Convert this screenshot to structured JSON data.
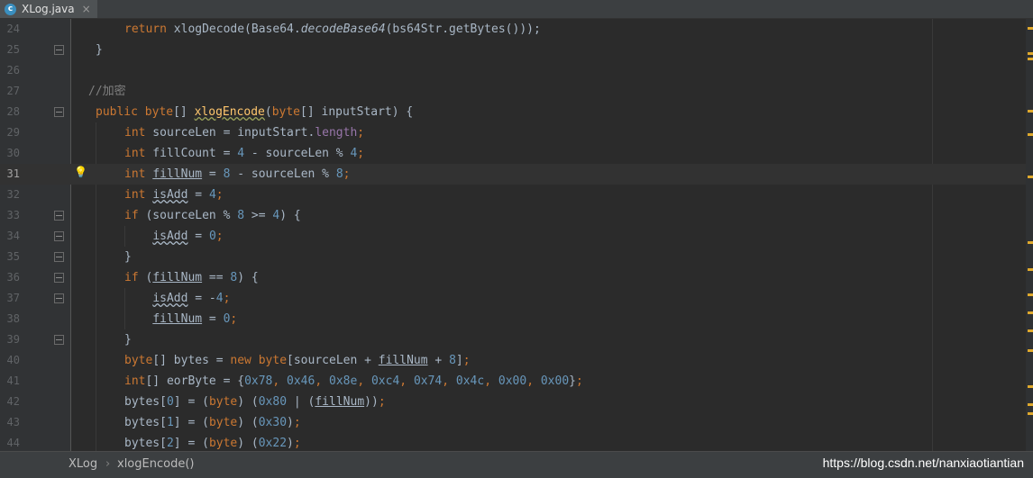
{
  "tab": {
    "icon": "java-class-icon",
    "title": "XLog.java",
    "close": "×"
  },
  "editor": {
    "current_line": 31,
    "lines": [
      {
        "n": "24",
        "code": "<span class=\"kw\">return</span> xlogDecode(Base64.<span class=\"ital\">decodeBase64</span>(bs64Str.getBytes())<span>);</span>"
      },
      {
        "n": "25",
        "code": "}"
      },
      {
        "n": "26",
        "code": ""
      },
      {
        "n": "27",
        "code": "<span class=\"cmt\">//加密</span>"
      },
      {
        "n": "28",
        "code": "<span class=\"kw\">public</span> <span class=\"kw\">byte</span>[] <span class=\"mth wavyok\">xlogEncode</span>(<span class=\"kw\">byte</span>[] inputStart) {"
      },
      {
        "n": "29",
        "code": "<span class=\"kw\">int</span> sourceLen = inputStart.<span class=\"fld\">length</span><span class=\"kw\">;</span>"
      },
      {
        "n": "30",
        "code": "<span class=\"kw\">int</span> fillCount = <span class=\"num\">4</span> - sourceLen % <span class=\"num\">4</span><span class=\"kw\">;</span>"
      },
      {
        "n": "31",
        "code": "<span class=\"kw\">int</span> <span class=\"und\">fillNum</span> = <span class=\"num\">8</span> - sourceLen % <span class=\"num\">8</span><span class=\"kw\">;</span>"
      },
      {
        "n": "32",
        "code": "<span class=\"kw\">int</span> <span class=\"wavy\">isAdd</span> = <span class=\"num\">4</span><span class=\"kw\">;</span>"
      },
      {
        "n": "33",
        "code": "<span class=\"kw\">if</span> (sourceLen % <span class=\"num\">8</span> &gt;= <span class=\"num\">4</span>) {"
      },
      {
        "n": "34",
        "code": "    <span class=\"wavy\">isAdd</span> = <span class=\"num\">0</span><span class=\"kw\">;</span>"
      },
      {
        "n": "35",
        "code": "}"
      },
      {
        "n": "36",
        "code": "<span class=\"kw\">if</span> (<span class=\"und\">fillNum</span> == <span class=\"num\">8</span>) {"
      },
      {
        "n": "37",
        "code": "    <span class=\"wavy\">isAdd</span> = -<span class=\"num\">4</span><span class=\"kw\">;</span>"
      },
      {
        "n": "38",
        "code": "    <span class=\"und\">fillNum</span> = <span class=\"num\">0</span><span class=\"kw\">;</span>"
      },
      {
        "n": "39",
        "code": "}"
      },
      {
        "n": "40",
        "code": "<span class=\"kw\">byte</span>[] bytes = <span class=\"kw\">new</span> <span class=\"kw\">byte</span>[sourceLen + <span class=\"und\">fillNum</span> + <span class=\"num\">8</span>]<span class=\"kw\">;</span>"
      },
      {
        "n": "41",
        "code": "<span class=\"kw\">int</span>[] eorByte = {<span class=\"num\">0x78</span><span class=\"kw\">,</span> <span class=\"num\">0x46</span><span class=\"kw\">,</span> <span class=\"num\">0x8e</span><span class=\"kw\">,</span> <span class=\"num\">0xc4</span><span class=\"kw\">,</span> <span class=\"num\">0x74</span><span class=\"kw\">,</span> <span class=\"num\">0x4c</span><span class=\"kw\">,</span> <span class=\"num\">0x00</span><span class=\"kw\">,</span> <span class=\"num\">0x00</span>}<span class=\"kw\">;</span>"
      },
      {
        "n": "42",
        "code": "bytes[<span class=\"num\">0</span>] = (<span class=\"kw\">byte</span>) (<span class=\"num\">0x80</span> | (<span class=\"und\">fillNum</span>))<span class=\"kw\">;</span>"
      },
      {
        "n": "43",
        "code": "bytes[<span class=\"num\">1</span>] = (<span class=\"kw\">byte</span>) (<span class=\"num\">0x30</span>)<span class=\"kw\">;</span>"
      },
      {
        "n": "44",
        "code": "bytes[<span class=\"num\">2</span>] = (<span class=\"kw\">byte</span>) (<span class=\"num\">0x22</span>)<span class=\"kw\">;</span>"
      }
    ]
  },
  "breadcrumb": {
    "items": [
      "XLog",
      "xlogEncode()"
    ],
    "separator": "›"
  },
  "watermark": "https://blog.csdn.net/nanxiaotiantian",
  "colors": {
    "keyword": "#cc7832",
    "number": "#6897bb",
    "method": "#ffc66d",
    "field": "#9876aa",
    "background": "#2b2b2b"
  }
}
